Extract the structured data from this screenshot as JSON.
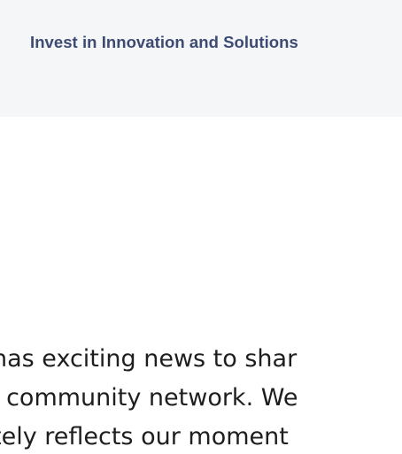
{
  "banner": {
    "link_label": "Invest in Innovation and Solutions"
  },
  "article": {
    "lines": [
      "has exciting news to shar",
      "l community network. We",
      "tely reflects our moment"
    ]
  }
}
